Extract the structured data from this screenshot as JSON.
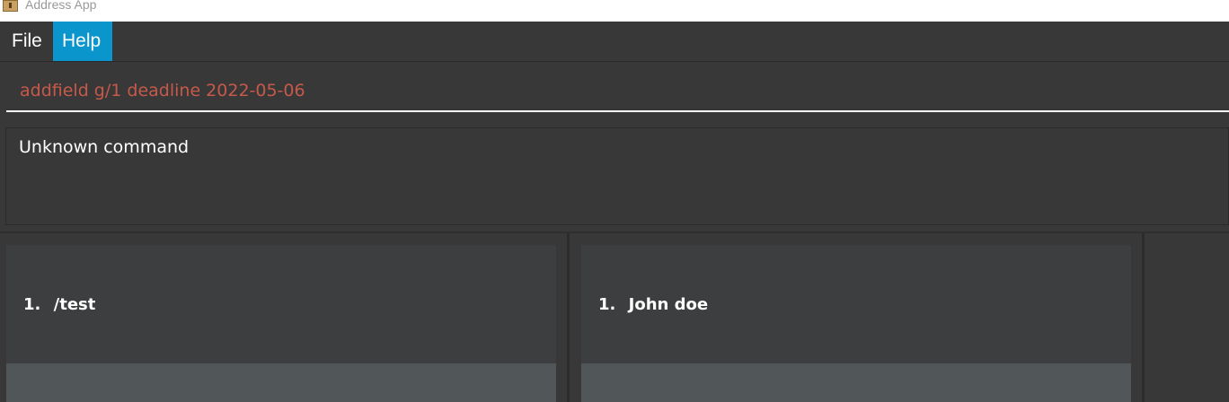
{
  "window": {
    "title": "Address App",
    "icon": "app-icon"
  },
  "menu": {
    "file_label": "File",
    "help_label": "Help"
  },
  "command": {
    "value": "addfield g/1 deadline 2022-05-06"
  },
  "result": {
    "text": "Unknown command"
  },
  "left_list": {
    "items": [
      {
        "index": "1.",
        "name": "/test"
      }
    ]
  },
  "right_list": {
    "items": [
      {
        "index": "1.",
        "name": "John doe"
      }
    ]
  },
  "colors": {
    "accent": "#0a96cc",
    "error_text": "#c65a4a",
    "background": "#383838",
    "card": "#3c3e3f"
  }
}
